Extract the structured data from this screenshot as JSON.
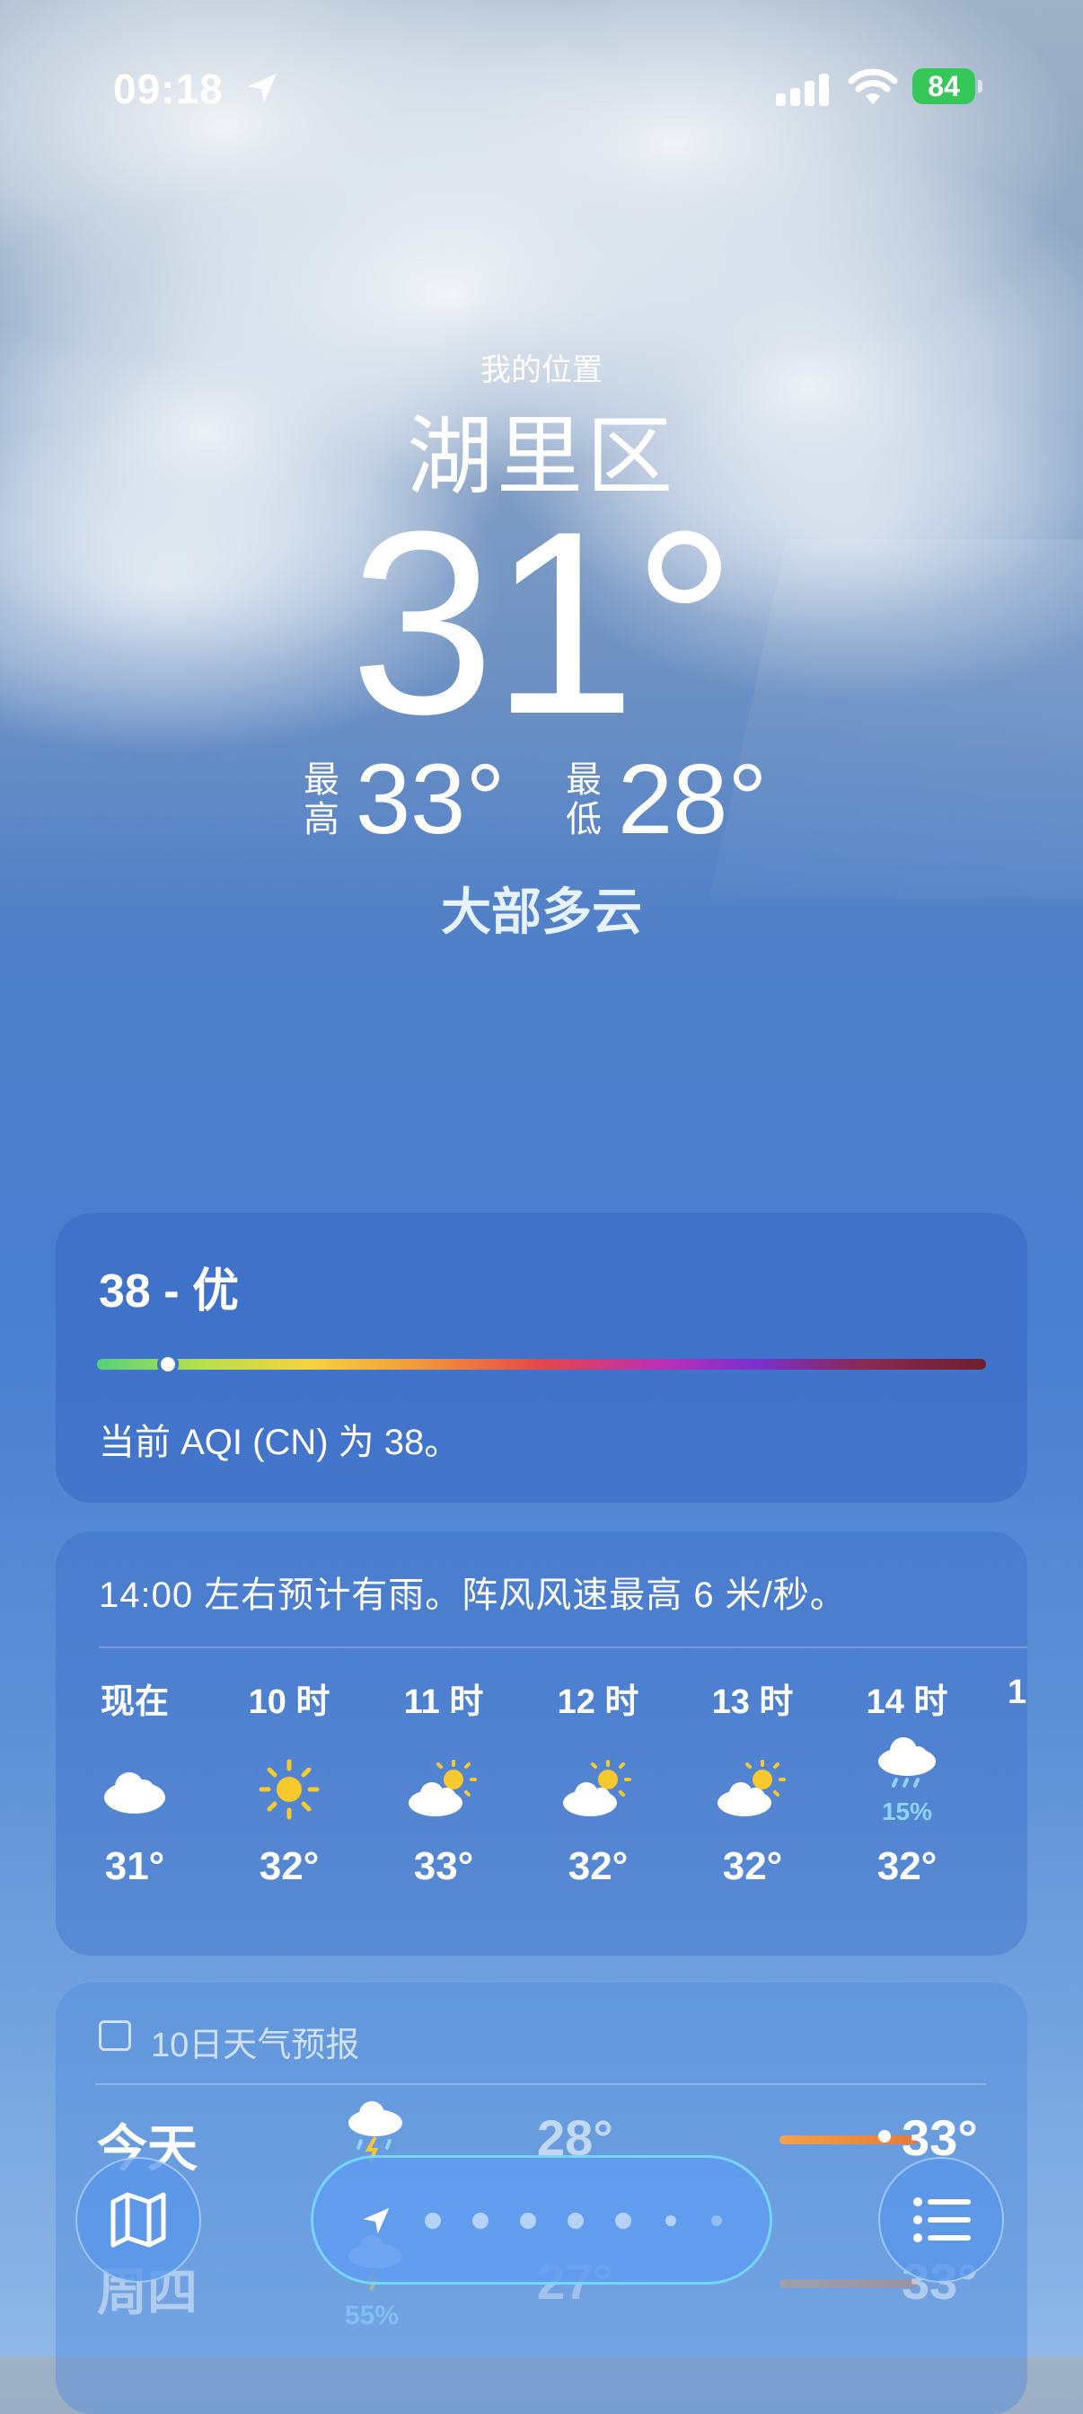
{
  "status_bar": {
    "time": "09:18",
    "battery": "84"
  },
  "header": {
    "my_location": "我的位置",
    "city": "湖里区",
    "temperature": "31°",
    "high_label": "最高",
    "high": "33°",
    "low_label": "最低",
    "low": "28°",
    "condition": "大部多云"
  },
  "aqi": {
    "title": "38 - 优",
    "description": "当前 AQI (CN) 为 38。",
    "level_fraction": 0.08
  },
  "hourly": {
    "note": "14:00 左右预计有雨。阵风风速最高 6 米/秒。",
    "items": [
      {
        "label": "现在",
        "icon": "cloud-icon",
        "temp": "31°",
        "precip": ""
      },
      {
        "label": "10 时",
        "icon": "sun-icon",
        "temp": "32°",
        "precip": ""
      },
      {
        "label": "11 时",
        "icon": "partly-cloudy-icon",
        "temp": "33°",
        "precip": ""
      },
      {
        "label": "12 时",
        "icon": "partly-cloudy-icon",
        "temp": "32°",
        "precip": ""
      },
      {
        "label": "13 时",
        "icon": "partly-cloudy-icon",
        "temp": "32°",
        "precip": ""
      },
      {
        "label": "14 时",
        "icon": "rain-cloud-icon",
        "temp": "32°",
        "precip": "15%"
      }
    ]
  },
  "ten_day": {
    "header": "10日天气预报",
    "rows": [
      {
        "day": "今天",
        "icon": "thunder-rain-icon",
        "low": "28°",
        "high": "33°",
        "precip": ""
      },
      {
        "day": "周四",
        "icon": "thunder-rain-icon",
        "low": "27°",
        "high": "33°",
        "precip": "55%"
      }
    ]
  },
  "toolbar": {
    "map_icon": "map-icon",
    "location_icon": "location-arrow-icon",
    "list_icon": "list-icon"
  },
  "colors": {
    "battery": "#36c759",
    "precip": "#8fd3ff",
    "sun": "#f7c92d"
  }
}
